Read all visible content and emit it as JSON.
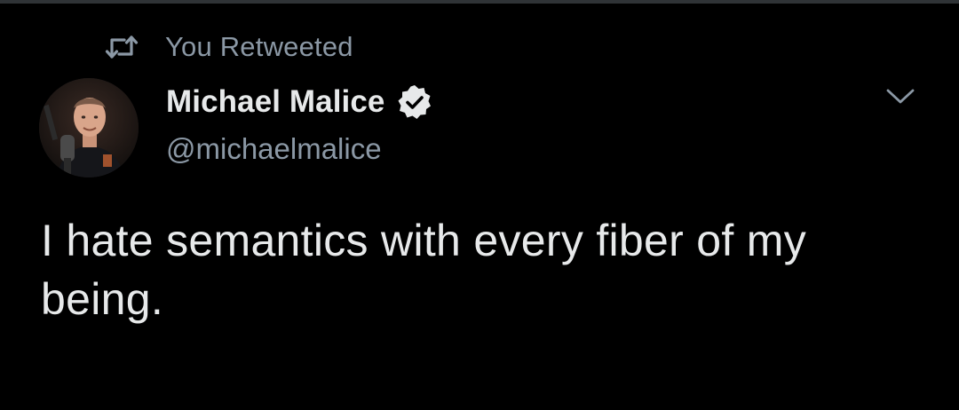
{
  "retweet_context": {
    "label": "You Retweeted",
    "icon": "retweet-icon"
  },
  "author": {
    "display_name": "Michael Malice",
    "handle": "@michaelmalice",
    "verified": true,
    "verified_icon": "verified-badge-icon",
    "avatar": "profile-photo"
  },
  "actions": {
    "more_icon": "chevron-down-icon"
  },
  "tweet": {
    "text": "I hate semantics with every fiber of my being."
  },
  "colors": {
    "background": "#000000",
    "primary_text": "#e7e9ea",
    "secondary_text": "#8b98a5"
  }
}
